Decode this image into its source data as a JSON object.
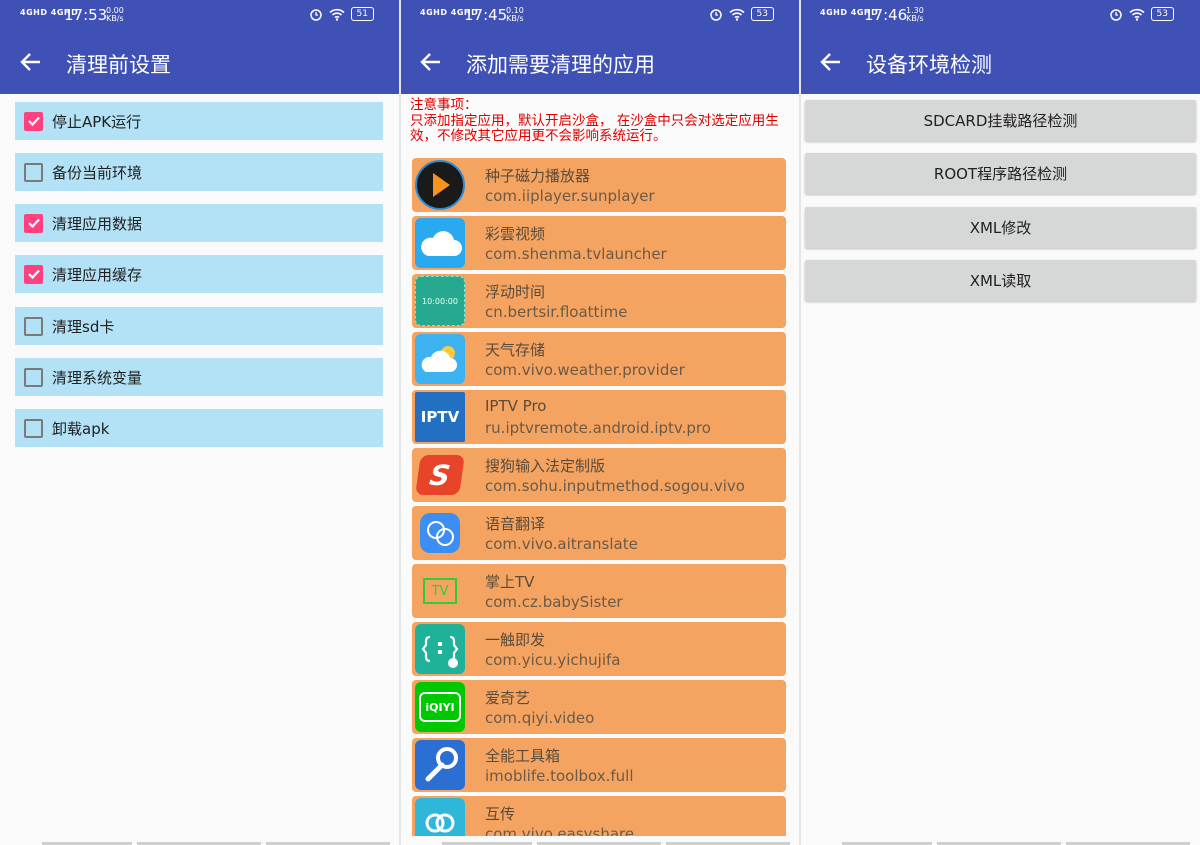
{
  "colors": {
    "primary": "#3f51b5",
    "accent": "#ff4081",
    "option_bg": "#b3e1f5",
    "app_row_bg": "#f4a460",
    "notice_red": "#e00000",
    "button_bg": "#d6d7d7"
  },
  "panels": [
    {
      "status": {
        "signal": "4GHD 4GHD",
        "time": "17:53",
        "speed_value": "0.00",
        "speed_unit": "KB/s",
        "battery": "51"
      },
      "title": "清理前设置",
      "options": [
        {
          "label": "停止APK运行",
          "checked": true
        },
        {
          "label": "备份当前环境",
          "checked": false
        },
        {
          "label": "清理应用数据",
          "checked": true
        },
        {
          "label": "清理应用缓存",
          "checked": true
        },
        {
          "label": "清理sd卡",
          "checked": false
        },
        {
          "label": "清理系统变量",
          "checked": false
        },
        {
          "label": "卸载apk",
          "checked": false
        }
      ]
    },
    {
      "status": {
        "signal": "4GHD 4GHD",
        "time": "17:45",
        "speed_value": "0.10",
        "speed_unit": "KB/s",
        "battery": "53"
      },
      "title": "添加需要清理的应用",
      "notice_title": "注意事项：",
      "notice_body": "只添加指定应用，默认开启沙盒， 在沙盒中只会对选定应用生效，不修改其它应用更不会影响系统运行。",
      "apps": [
        {
          "name": "种子磁力播放器",
          "package": "com.iiplayer.sunplayer",
          "icon": "play-icon"
        },
        {
          "name": "彩雲视频",
          "package": "com.shenma.tvlauncher",
          "icon": "cloud-icon"
        },
        {
          "name": "浮动时间",
          "package": "cn.bertsir.floattime",
          "icon": "clock-icon",
          "icon_text": "10:00:00"
        },
        {
          "name": "天气存储",
          "package": "com.vivo.weather.provider",
          "icon": "weather-icon"
        },
        {
          "name": "IPTV Pro",
          "package": "ru.iptvremote.android.iptv.pro",
          "icon": "iptv-icon",
          "icon_text": "IPTV"
        },
        {
          "name": "搜狗输入法定制版",
          "package": "com.sohu.inputmethod.sogou.vivo",
          "icon": "sogou-icon",
          "icon_text": "S"
        },
        {
          "name": "语音翻译",
          "package": "com.vivo.aitranslate",
          "icon": "translate-icon"
        },
        {
          "name": "掌上TV",
          "package": "com.cz.babySister",
          "icon": "tv-icon",
          "icon_text": "TV"
        },
        {
          "name": "一触即发",
          "package": "com.yicu.yichujifa",
          "icon": "touch-icon"
        },
        {
          "name": "爱奇艺",
          "package": "com.qiyi.video",
          "icon": "iqiyi-icon",
          "icon_text": "iQIYI"
        },
        {
          "name": "全能工具箱",
          "package": "imoblife.toolbox.full",
          "icon": "wrench-icon"
        },
        {
          "name": "互传",
          "package": "com.vivo.easyshare",
          "icon": "share-icon"
        }
      ]
    },
    {
      "status": {
        "signal": "4GHD 4GHD",
        "time": "17:46",
        "speed_value": "1.30",
        "speed_unit": "KB/s",
        "battery": "53"
      },
      "title": "设备环境检测",
      "buttons": [
        "SDCARD挂载路径检测",
        "ROOT程序路径检测",
        "XML修改",
        "XML读取"
      ]
    }
  ]
}
